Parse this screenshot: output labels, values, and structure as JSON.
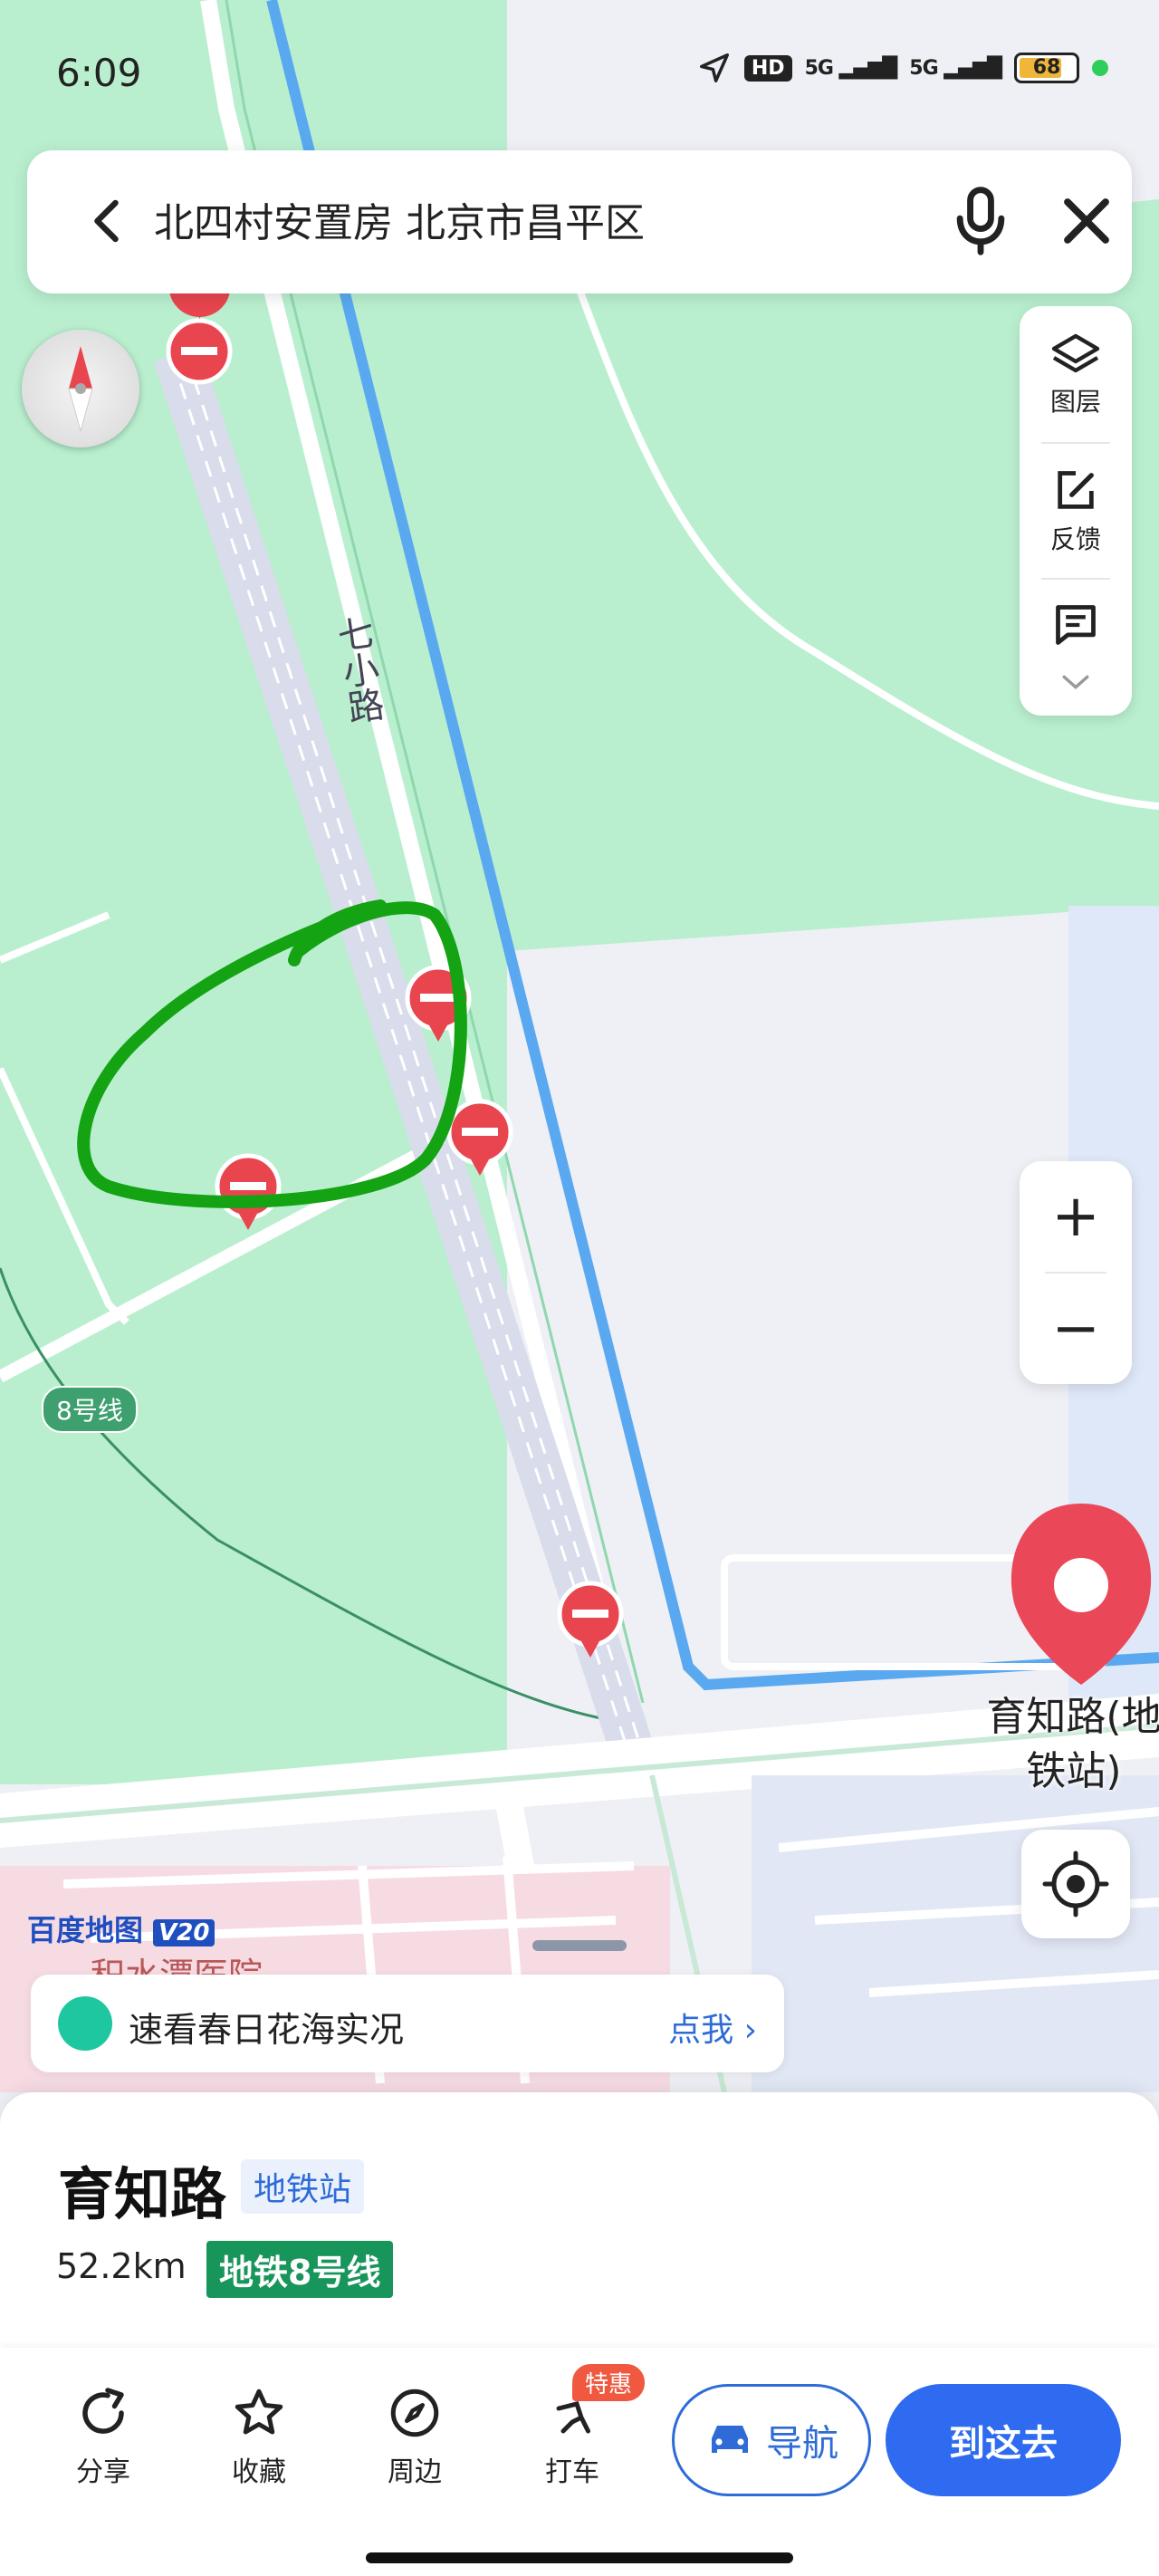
{
  "status_bar": {
    "time": "6:09",
    "hd": "HD",
    "net1": "5G",
    "net2": "5G",
    "battery": "68"
  },
  "search": {
    "query": "北四村安置房 北京市昌平区"
  },
  "side_panel": {
    "layers_label": "图层",
    "feedback_label": "反馈"
  },
  "map": {
    "road_label": "七小路",
    "metro_line_badge": "8号线",
    "place_label": "育知路(地铁站)",
    "hospital_label": "积水潭医院",
    "brand": "百度地图",
    "brand_version": "V20",
    "zoom_in": "+",
    "zoom_out": "−"
  },
  "promo": {
    "text": "速看春日花海实况",
    "cta": "点我 ›"
  },
  "place": {
    "name": "育知路",
    "type": "地铁站",
    "distance": "52.2km",
    "line": "地铁8号线"
  },
  "toolbar": {
    "share": "分享",
    "favorite": "收藏",
    "nearby": "周边",
    "taxi": "打车",
    "taxi_tag": "特惠",
    "navigate": "导航",
    "go_here": "到这去"
  },
  "colors": {
    "park_green": "#b9efcf",
    "river": "#5aa9f0",
    "accent_blue": "#2e6bf0",
    "metro_green": "#17955a",
    "marker_red": "#e8454f",
    "annotation_green": "#13a313"
  }
}
